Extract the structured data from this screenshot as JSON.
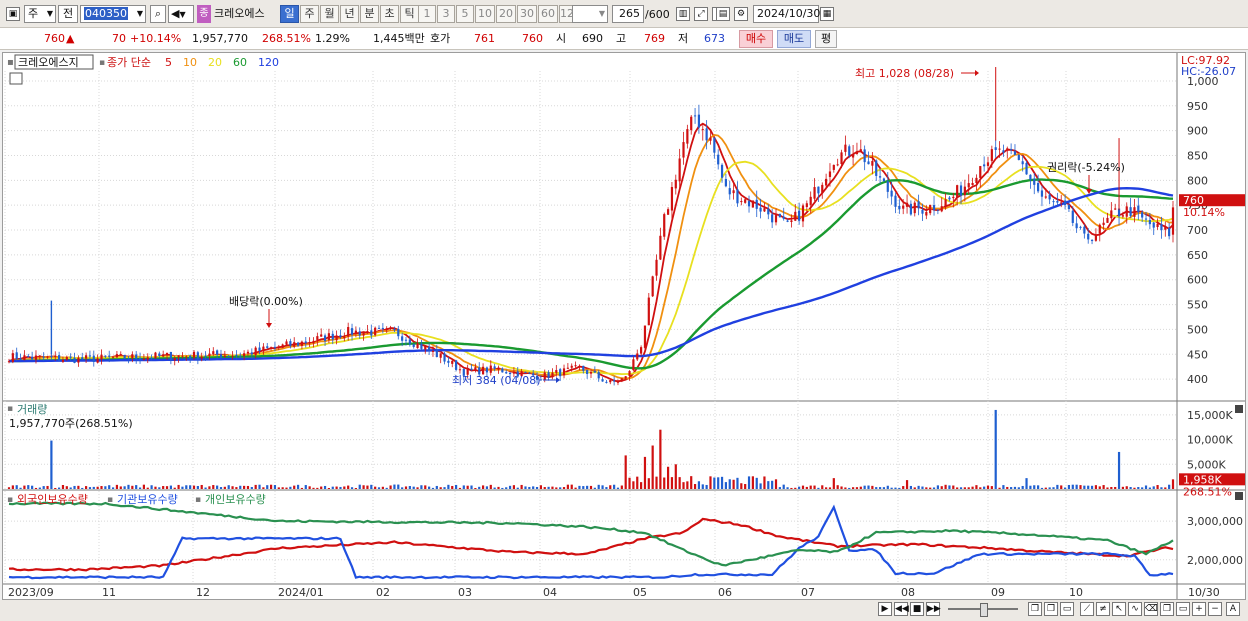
{
  "toolbar": {
    "mode": "주",
    "range": "전",
    "code": "040350",
    "badge": "종",
    "name": "크레오에스",
    "periods": [
      "일",
      "주",
      "월",
      "년",
      "분",
      "초",
      "틱"
    ],
    "active_period": "일",
    "intervals": [
      "1",
      "3",
      "5",
      "10",
      "20",
      "30",
      "60",
      "120"
    ],
    "count": "265",
    "count_total": "/600",
    "date": "2024/10/30"
  },
  "quote": {
    "price": "760",
    "arrow": "▲",
    "change": "70",
    "change_pct": "+10.14%",
    "volume": "1,957,770",
    "vol_ratio": "268.51%",
    "turnover": "1.29%",
    "amount": "1,445백만",
    "hoga_label": "호가",
    "ask": "761",
    "bid": "760",
    "open_label": "시",
    "open": "690",
    "high_label": "고",
    "high": "769",
    "low_label": "저",
    "low": "673",
    "buy_button": "매수",
    "sell_button": "매도",
    "eval_button": "평"
  },
  "legend": {
    "title": "크레오에스지",
    "ma_prefix": "종가 단순",
    "ma_periods": [
      "5",
      "10",
      "20",
      "60",
      "120"
    ],
    "ma_colors": [
      "#d01010",
      "#f09010",
      "#e8e020",
      "#1a9a30",
      "#2040e0"
    ],
    "lc": "LC:97.92",
    "hc": "HC:-26.07"
  },
  "annotations": {
    "high": "최고 1,028 (08/28)",
    "low": "최저 384 (04/08)",
    "dividend": "배당락(0.00%)",
    "rights": "권리락(-5.24%)",
    "last_price": "760",
    "last_pct": "10.14%"
  },
  "volume_panel": {
    "title": "거래량",
    "value": "1,957,770주(268.51%)",
    "last_label": "1,958K",
    "last_pct": "268.51%"
  },
  "holdings_panel": {
    "series": [
      {
        "name": "외국인보유수량",
        "color": "#d01010"
      },
      {
        "name": "기관보유수량",
        "color": "#2050e0"
      },
      {
        "name": "개인보유수량",
        "color": "#2a9050"
      }
    ]
  },
  "colors": {
    "up": "#d01010",
    "down": "#1f5fd0"
  },
  "chart_data": {
    "type": "candlestick",
    "x_labels": [
      "2023/09",
      "11",
      "12",
      "2024/01",
      "02",
      "03",
      "04",
      "05",
      "06",
      "07",
      "08",
      "09",
      "10",
      "10/30"
    ],
    "price_ticks": [
      "1,000",
      "950",
      "900",
      "850",
      "800",
      "750",
      "700",
      "650",
      "600",
      "550",
      "500",
      "450",
      "400"
    ],
    "price_range": [
      360,
      1020
    ],
    "volume_ticks": [
      "15,000K",
      "10,000K",
      "5,000K"
    ],
    "holding_ticks": [
      "3,000,000",
      "2,000,000"
    ],
    "anchors": [
      {
        "t": 0,
        "p": 445
      },
      {
        "t": 18,
        "p": 440
      },
      {
        "t": 35,
        "p": 445
      },
      {
        "t": 60,
        "p": 450
      },
      {
        "t": 75,
        "p": 472
      },
      {
        "t": 88,
        "p": 495
      },
      {
        "t": 100,
        "p": 495
      },
      {
        "t": 112,
        "p": 445
      },
      {
        "t": 118,
        "p": 415
      },
      {
        "t": 126,
        "p": 420
      },
      {
        "t": 138,
        "p": 405
      },
      {
        "t": 148,
        "p": 422
      },
      {
        "t": 156,
        "p": 392
      },
      {
        "t": 160,
        "p": 402
      },
      {
        "t": 164,
        "p": 470
      },
      {
        "t": 170,
        "p": 720
      },
      {
        "t": 175,
        "p": 875
      },
      {
        "t": 178,
        "p": 930
      },
      {
        "t": 182,
        "p": 880
      },
      {
        "t": 186,
        "p": 780
      },
      {
        "t": 195,
        "p": 745
      },
      {
        "t": 202,
        "p": 705
      },
      {
        "t": 208,
        "p": 760
      },
      {
        "t": 214,
        "p": 845
      },
      {
        "t": 220,
        "p": 868
      },
      {
        "t": 226,
        "p": 800
      },
      {
        "t": 232,
        "p": 740
      },
      {
        "t": 238,
        "p": 745
      },
      {
        "t": 244,
        "p": 760
      },
      {
        "t": 248,
        "p": 790
      },
      {
        "t": 253,
        "p": 842
      },
      {
        "t": 258,
        "p": 858
      },
      {
        "t": 263,
        "p": 830
      },
      {
        "t": 268,
        "p": 765
      },
      {
        "t": 274,
        "p": 740
      },
      {
        "t": 279,
        "p": 680
      },
      {
        "t": 283,
        "p": 700
      },
      {
        "t": 287,
        "p": 735
      },
      {
        "t": 291,
        "p": 740
      },
      {
        "t": 295,
        "p": 715
      },
      {
        "t": 299,
        "p": 698
      },
      {
        "t": 301,
        "p": 694
      },
      {
        "t": 302,
        "p": 740
      }
    ],
    "volume_spikes": [
      {
        "t": 11,
        "v": 9800
      },
      {
        "t": 160,
        "v": 6800
      },
      {
        "t": 163,
        "v": 2500
      },
      {
        "t": 165,
        "v": 6500
      },
      {
        "t": 167,
        "v": 8800
      },
      {
        "t": 169,
        "v": 12000
      },
      {
        "t": 171,
        "v": 4500
      },
      {
        "t": 173,
        "v": 5000
      },
      {
        "t": 177,
        "v": 2600
      },
      {
        "t": 214,
        "v": 2200
      },
      {
        "t": 233,
        "v": 1800
      },
      {
        "t": 256,
        "v": 16000
      },
      {
        "t": 264,
        "v": 2200
      },
      {
        "t": 288,
        "v": 7500
      },
      {
        "t": 302,
        "v": 1958
      }
    ],
    "holdings": {
      "foreign": [
        {
          "t": 0,
          "v": 1.75
        },
        {
          "t": 20,
          "v": 1.75
        },
        {
          "t": 40,
          "v": 1.85
        },
        {
          "t": 70,
          "v": 2.3
        },
        {
          "t": 100,
          "v": 2.45
        },
        {
          "t": 130,
          "v": 2.2
        },
        {
          "t": 150,
          "v": 2.15
        },
        {
          "t": 165,
          "v": 2.55
        },
        {
          "t": 175,
          "v": 2.7
        },
        {
          "t": 180,
          "v": 3.05
        },
        {
          "t": 190,
          "v": 2.9
        },
        {
          "t": 200,
          "v": 2.6
        },
        {
          "t": 215,
          "v": 2.35
        },
        {
          "t": 235,
          "v": 2.4
        },
        {
          "t": 255,
          "v": 2.3
        },
        {
          "t": 270,
          "v": 2.2
        },
        {
          "t": 290,
          "v": 2.1
        },
        {
          "t": 300,
          "v": 2.3
        }
      ],
      "institution": [
        {
          "t": 0,
          "v": 1.55
        },
        {
          "t": 40,
          "v": 1.55
        },
        {
          "t": 45,
          "v": 2.55
        },
        {
          "t": 86,
          "v": 2.55
        },
        {
          "t": 90,
          "v": 1.55
        },
        {
          "t": 170,
          "v": 1.55
        },
        {
          "t": 178,
          "v": 1.62
        },
        {
          "t": 198,
          "v": 1.62
        },
        {
          "t": 205,
          "v": 2.3
        },
        {
          "t": 210,
          "v": 2.6
        },
        {
          "t": 214,
          "v": 3.35
        },
        {
          "t": 218,
          "v": 2.25
        },
        {
          "t": 225,
          "v": 2.25
        },
        {
          "t": 230,
          "v": 1.65
        },
        {
          "t": 240,
          "v": 1.65
        },
        {
          "t": 252,
          "v": 2.15
        },
        {
          "t": 285,
          "v": 2.15
        },
        {
          "t": 292,
          "v": 2.1
        },
        {
          "t": 296,
          "v": 1.6
        },
        {
          "t": 302,
          "v": 1.65
        }
      ],
      "individual": [
        {
          "t": 0,
          "v": 3.45
        },
        {
          "t": 25,
          "v": 3.45
        },
        {
          "t": 70,
          "v": 3.0
        },
        {
          "t": 130,
          "v": 2.95
        },
        {
          "t": 150,
          "v": 2.85
        },
        {
          "t": 165,
          "v": 2.7
        },
        {
          "t": 175,
          "v": 2.25
        },
        {
          "t": 185,
          "v": 1.85
        },
        {
          "t": 205,
          "v": 2.25
        },
        {
          "t": 215,
          "v": 2.2
        },
        {
          "t": 225,
          "v": 2.7
        },
        {
          "t": 245,
          "v": 2.75
        },
        {
          "t": 265,
          "v": 2.65
        },
        {
          "t": 285,
          "v": 2.5
        },
        {
          "t": 295,
          "v": 2.15
        },
        {
          "t": 302,
          "v": 2.5
        }
      ]
    }
  }
}
